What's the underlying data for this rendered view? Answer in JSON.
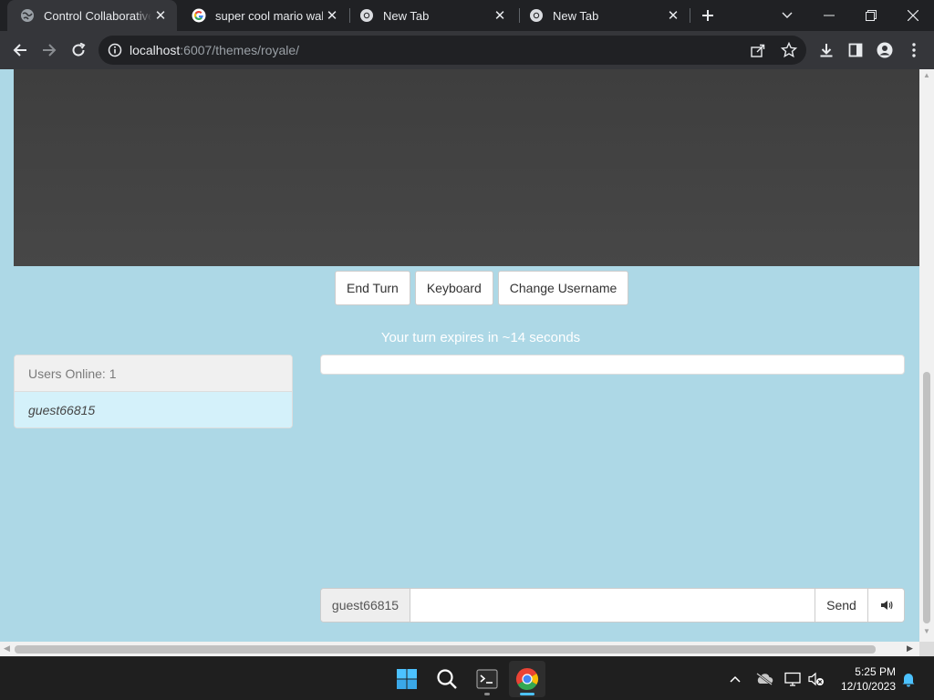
{
  "browser": {
    "tabs": [
      {
        "title": "Control Collaborative",
        "active": true,
        "icon": "globe-icon"
      },
      {
        "title": "super cool mario wallp",
        "active": false,
        "icon": "google-icon"
      },
      {
        "title": "New Tab",
        "active": false,
        "icon": "chrome-icon"
      },
      {
        "title": "New Tab",
        "active": false,
        "icon": "chrome-icon"
      }
    ],
    "url_host": "localhost",
    "url_path": ":6007/themes/royale/"
  },
  "page": {
    "buttons": {
      "end_turn": "End Turn",
      "keyboard": "Keyboard",
      "change_username": "Change Username"
    },
    "turn_notice": "Your turn expires in ~14 seconds",
    "users": {
      "heading": "Users Online: 1",
      "list": [
        "guest66815"
      ]
    },
    "chat": {
      "username": "guest66815",
      "input_value": "",
      "send_label": "Send"
    }
  },
  "taskbar": {
    "time": "5:25 PM",
    "date": "12/10/2023"
  },
  "colors": {
    "page_background": "#add8e6",
    "game_screen": "#444444",
    "user_row": "#d4f1fa",
    "accent": "#4cc2ff"
  }
}
